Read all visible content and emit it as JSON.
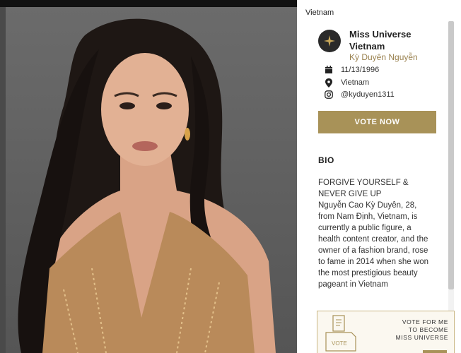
{
  "profile": {
    "country_top": "Vietnam",
    "title": "Miss Universe Vietnam",
    "name": "Kỳ Duyên Nguyễn",
    "birthdate": "11/13/1996",
    "location": "Vietnam",
    "instagram": "@kyduyen1311"
  },
  "actions": {
    "vote_label": "VOTE NOW"
  },
  "bio": {
    "heading": "BIO",
    "headline": "FORGIVE YOURSELF & NEVER GIVE UP",
    "text": "Nguyễn Cao Kỳ Duyên, 28, from Nam Định, Vietnam, is currently a public figure, a health content creator, and the owner of a fashion brand, rose to fame in 2014 when she won the most prestigious beauty pageant in Vietnam"
  },
  "banner": {
    "line1": "VOTE FOR ME",
    "line2": "TO BECOME",
    "line3": "MISS UNIVERSE",
    "box_label": "VOTE"
  },
  "icons": {
    "logo": "star-globe-logo",
    "birthdate": "calendar-icon",
    "location": "location-pin-icon",
    "instagram": "instagram-icon"
  },
  "colors": {
    "accent": "#a89258",
    "logo_bg": "#2a2a2a",
    "photo_bg": "#666666"
  }
}
